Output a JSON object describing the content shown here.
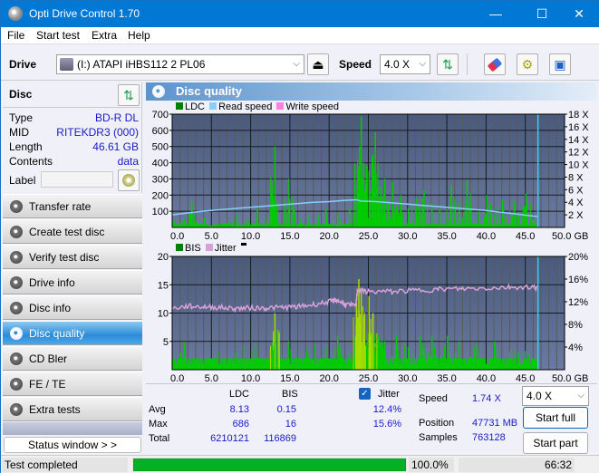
{
  "window": {
    "title": "Opti Drive Control 1.70",
    "controls": {
      "minimize": "—",
      "maximize": "☐",
      "close": "✕"
    }
  },
  "menu": [
    "File",
    "Start test",
    "Extra",
    "Help"
  ],
  "toolbar": {
    "drive_label": "Drive",
    "drive_value": "(I:)  ATAPI iHBS112   2 PL06",
    "speed_label": "Speed",
    "speed_value": "4.0 X",
    "icons": [
      "eject-icon",
      "refresh-icon",
      "erase-icon",
      "settings-icon",
      "save-icon"
    ]
  },
  "disc": {
    "title": "Disc",
    "rows": [
      {
        "key": "Type",
        "value": "BD-R DL"
      },
      {
        "key": "MID",
        "value": "RITEKDR3 (000)"
      },
      {
        "key": "Length",
        "value": "46.61 GB"
      },
      {
        "key": "Contents",
        "value": "data"
      }
    ],
    "label_key": "Label",
    "label_value": ""
  },
  "nav": [
    {
      "label": "Transfer rate",
      "active": false
    },
    {
      "label": "Create test disc",
      "active": false
    },
    {
      "label": "Verify test disc",
      "active": false
    },
    {
      "label": "Drive info",
      "active": false
    },
    {
      "label": "Disc info",
      "active": false
    },
    {
      "label": "Disc quality",
      "active": true
    },
    {
      "label": "CD Bler",
      "active": false
    },
    {
      "label": "FE / TE",
      "active": false
    },
    {
      "label": "Extra tests",
      "active": false
    }
  ],
  "status_window_label": "Status window > >",
  "panel_title": "Disc quality",
  "colors": {
    "ldc": "#008000",
    "read_speed": "#87cefa",
    "write_speed": "#ff80e0",
    "bis": "#008000",
    "jitter": "#d8a0d8",
    "bar_green": "#00cc00",
    "bar_yellow": "#aadd00",
    "plot_bg_top": "#4a5a7c",
    "plot_bg_bottom": "#6a7aa0"
  },
  "chart_data": [
    {
      "type": "bar",
      "title": "LDC / Read speed",
      "legend": [
        "LDC",
        "Read speed",
        "Write speed"
      ],
      "xlabel": "GB",
      "x_ticks": [
        "0.0",
        "5.0",
        "10.0",
        "15.0",
        "20.0",
        "25.0",
        "30.0",
        "35.0",
        "40.0",
        "45.0",
        "50.0 GB"
      ],
      "xlim": [
        0,
        50
      ],
      "y_ticks": [
        "700",
        "600",
        "500",
        "400",
        "300",
        "200",
        "100"
      ],
      "ylim": [
        0,
        700
      ],
      "y2_ticks": [
        "18 X",
        "16 X",
        "14 X",
        "12 X",
        "10 X",
        "8 X",
        "6 X",
        "4 X",
        "2 X"
      ],
      "y2lim": [
        0,
        18
      ],
      "end_marker_gb": 46.61,
      "ldc_peaks": [
        {
          "x": 0.2,
          "y": 40
        },
        {
          "x": 1.5,
          "y": 50
        },
        {
          "x": 2.4,
          "y": 160
        },
        {
          "x": 3.0,
          "y": 40
        },
        {
          "x": 4.0,
          "y": 60
        },
        {
          "x": 8.2,
          "y": 80
        },
        {
          "x": 9.5,
          "y": 50
        },
        {
          "x": 10.8,
          "y": 120
        },
        {
          "x": 12.0,
          "y": 30
        },
        {
          "x": 12.8,
          "y": 180
        },
        {
          "x": 13.0,
          "y": 500
        },
        {
          "x": 13.3,
          "y": 150
        },
        {
          "x": 14.8,
          "y": 300
        },
        {
          "x": 15.5,
          "y": 110
        },
        {
          "x": 17.2,
          "y": 70
        },
        {
          "x": 18.5,
          "y": 80
        },
        {
          "x": 19.5,
          "y": 120
        },
        {
          "x": 21.0,
          "y": 90
        },
        {
          "x": 22.5,
          "y": 120
        },
        {
          "x": 23.5,
          "y": 250
        },
        {
          "x": 23.8,
          "y": 500
        },
        {
          "x": 24.0,
          "y": 686
        },
        {
          "x": 24.3,
          "y": 400
        },
        {
          "x": 24.7,
          "y": 380
        },
        {
          "x": 25.0,
          "y": 350
        },
        {
          "x": 25.5,
          "y": 450
        },
        {
          "x": 25.8,
          "y": 590
        },
        {
          "x": 26.5,
          "y": 250
        },
        {
          "x": 27.0,
          "y": 300
        },
        {
          "x": 28.0,
          "y": 280
        },
        {
          "x": 29.0,
          "y": 200
        },
        {
          "x": 30.0,
          "y": 120
        },
        {
          "x": 31.0,
          "y": 180
        },
        {
          "x": 32.0,
          "y": 230
        },
        {
          "x": 33.0,
          "y": 150
        },
        {
          "x": 34.0,
          "y": 120
        },
        {
          "x": 35.5,
          "y": 260
        },
        {
          "x": 36.5,
          "y": 150
        },
        {
          "x": 37.5,
          "y": 290
        },
        {
          "x": 39.0,
          "y": 100
        },
        {
          "x": 40.0,
          "y": 200
        },
        {
          "x": 42.0,
          "y": 170
        },
        {
          "x": 43.5,
          "y": 160
        },
        {
          "x": 45.0,
          "y": 210
        },
        {
          "x": 46.0,
          "y": 50
        }
      ],
      "read_speed_x": [
        0,
        2,
        4,
        6,
        8,
        10,
        12,
        14,
        16,
        18,
        20,
        22,
        23.5,
        24,
        26,
        28,
        30,
        32,
        34,
        36,
        38,
        40,
        42,
        44,
        46,
        46.61
      ],
      "read_speed_y": [
        2.0,
        2.3,
        2.6,
        2.8,
        3.0,
        3.2,
        3.4,
        3.6,
        3.8,
        4.0,
        4.1,
        4.3,
        4.4,
        4.2,
        4.1,
        3.9,
        3.7,
        3.5,
        3.3,
        3.1,
        2.9,
        2.7,
        2.4,
        2.1,
        1.8,
        1.74
      ]
    },
    {
      "type": "bar",
      "title": "BIS / Jitter",
      "legend": [
        "BIS",
        "Jitter"
      ],
      "xlabel": "GB",
      "x_ticks": [
        "0.0",
        "5.0",
        "10.0",
        "15.0",
        "20.0",
        "25.0",
        "30.0",
        "35.0",
        "40.0",
        "45.0",
        "50.0 GB"
      ],
      "xlim": [
        0,
        50
      ],
      "y_ticks": [
        "20",
        "15",
        "10",
        "5"
      ],
      "ylim": [
        0,
        20
      ],
      "y2_ticks": [
        "20%",
        "16%",
        "12%",
        "8%",
        "4%"
      ],
      "y2lim": [
        0,
        20
      ],
      "end_marker_gb": 46.61,
      "bis_peaks": [
        {
          "x": 1,
          "y": 3
        },
        {
          "x": 5,
          "y": 2
        },
        {
          "x": 8,
          "y": 3
        },
        {
          "x": 10.5,
          "y": 2
        },
        {
          "x": 12.8,
          "y": 6
        },
        {
          "x": 13.0,
          "y": 10
        },
        {
          "x": 13.3,
          "y": 7
        },
        {
          "x": 14.8,
          "y": 5
        },
        {
          "x": 17,
          "y": 3
        },
        {
          "x": 19.5,
          "y": 4
        },
        {
          "x": 21.0,
          "y": 6
        },
        {
          "x": 22.5,
          "y": 3
        },
        {
          "x": 23.4,
          "y": 12
        },
        {
          "x": 23.7,
          "y": 16
        },
        {
          "x": 24.0,
          "y": 14
        },
        {
          "x": 24.4,
          "y": 9
        },
        {
          "x": 25.0,
          "y": 13
        },
        {
          "x": 25.5,
          "y": 10
        },
        {
          "x": 26.2,
          "y": 6
        },
        {
          "x": 27.0,
          "y": 5
        },
        {
          "x": 28.5,
          "y": 6
        },
        {
          "x": 30.0,
          "y": 4
        },
        {
          "x": 31.5,
          "y": 6
        },
        {
          "x": 33.0,
          "y": 6
        },
        {
          "x": 35.0,
          "y": 6
        },
        {
          "x": 36.5,
          "y": 5
        },
        {
          "x": 38.5,
          "y": 3
        },
        {
          "x": 41.0,
          "y": 5
        },
        {
          "x": 44.0,
          "y": 3
        },
        {
          "x": 46.0,
          "y": 2
        }
      ],
      "jitter_x": [
        0,
        2,
        4,
        6,
        8,
        10,
        12,
        14,
        16,
        18,
        20,
        21,
        22,
        23.4,
        23.6,
        25,
        28,
        31,
        34,
        37,
        40,
        43,
        46,
        46.61
      ],
      "jitter_y": [
        10.8,
        11.2,
        11.1,
        11.0,
        10.8,
        10.9,
        10.9,
        11.0,
        11.1,
        11.5,
        12.0,
        12.3,
        11.6,
        11.2,
        14.0,
        13.8,
        13.8,
        14.0,
        14.2,
        14.3,
        14.4,
        14.6,
        14.6,
        14.5
      ]
    }
  ],
  "stats": {
    "col_ldc": "LDC",
    "col_bis": "BIS",
    "jitter_label": "Jitter",
    "jitter_checked": true,
    "rows": [
      {
        "label": "Avg",
        "ldc": "8.13",
        "bis": "0.15",
        "jitter": "12.4%"
      },
      {
        "label": "Max",
        "ldc": "686",
        "bis": "16",
        "jitter": "15.6%"
      },
      {
        "label": "Total",
        "ldc": "6210121",
        "bis": "116869",
        "jitter": ""
      }
    ],
    "speed_label": "Speed",
    "speed_value": "1.74 X",
    "position_label": "Position",
    "position_value": "47731 MB",
    "samples_label": "Samples",
    "samples_value": "763128",
    "speed_select": "4.0 X",
    "start_full": "Start full",
    "start_part": "Start part"
  },
  "statusbar": {
    "status": "Test completed",
    "progress_percent": 100.0,
    "progress_text": "100.0%",
    "time": "66:32"
  }
}
